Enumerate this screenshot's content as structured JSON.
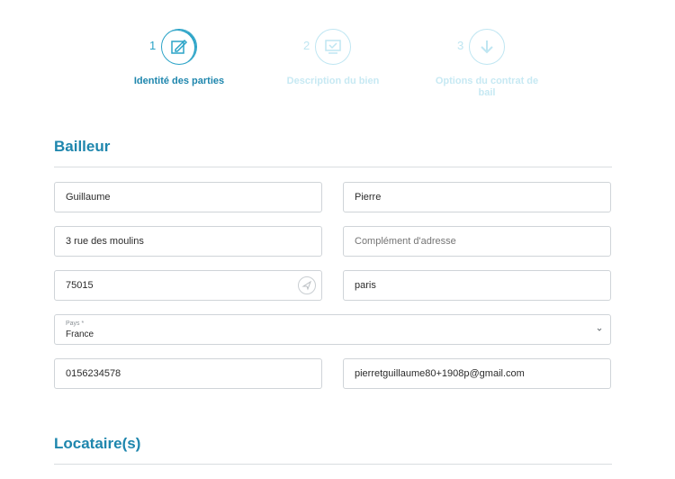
{
  "stepper": {
    "steps": [
      {
        "number": "1",
        "label": "Identité des parties",
        "state": "active",
        "icon": "edit-document-icon"
      },
      {
        "number": "2",
        "label": "Description du bien",
        "state": "inactive",
        "icon": "monitor-check-icon"
      },
      {
        "number": "3",
        "label": "Options du contrat de bail",
        "state": "inactive",
        "icon": "arrow-down-icon"
      }
    ]
  },
  "bailleur": {
    "title": "Bailleur",
    "first_name": "Guillaume",
    "last_name": "Pierre",
    "address": "3 rue des moulins",
    "address_complement_placeholder": "Complément d'adresse",
    "postal_code": "75015",
    "city": "paris",
    "country_label": "Pays *",
    "country_value": "France",
    "phone": "0156234578",
    "email": "pierretguillaume80+1908p@gmail.com"
  },
  "locataire": {
    "title": "Locataire(s)"
  },
  "colors": {
    "accent": "#1e86ad",
    "accent_light": "#bfe6f2",
    "border": "#cfd4d8"
  }
}
